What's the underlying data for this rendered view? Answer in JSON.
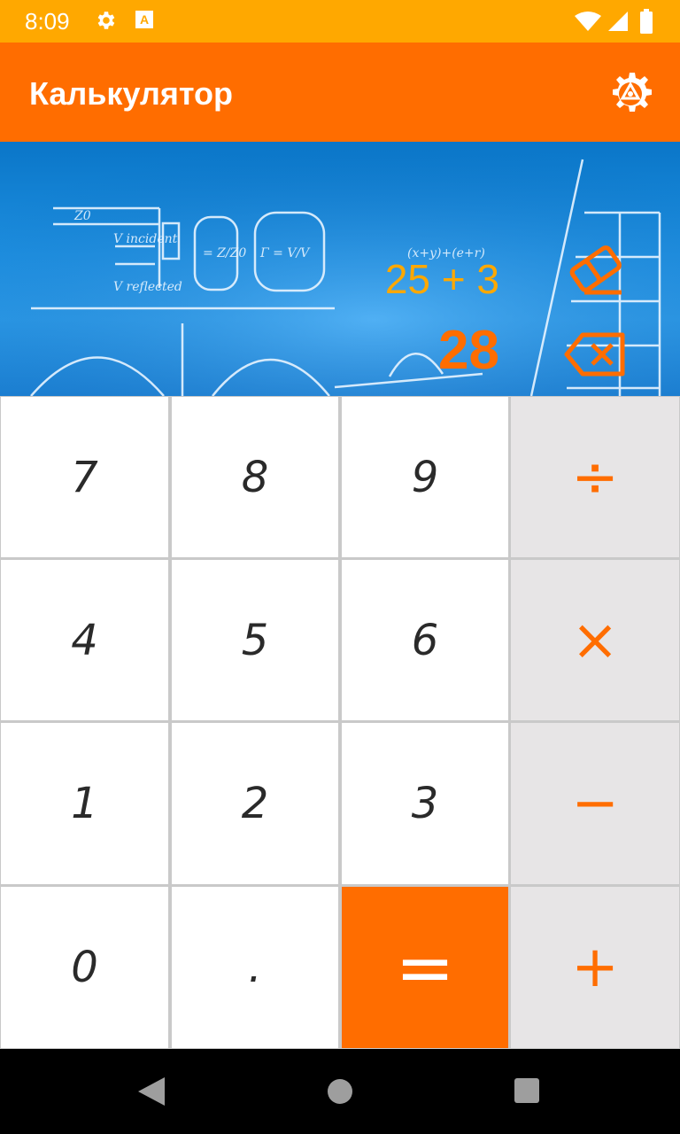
{
  "status_bar": {
    "time": "8:09",
    "background": "#ffa800"
  },
  "app_bar": {
    "title": "Калькулятор",
    "background": "#ff6d00"
  },
  "display": {
    "expression": "25 + 3",
    "result": "28",
    "expression_color": "#ffa800",
    "result_color": "#ff6d00"
  },
  "keypad": {
    "rows": [
      [
        {
          "label": "7",
          "type": "digit"
        },
        {
          "label": "8",
          "type": "digit"
        },
        {
          "label": "9",
          "type": "digit"
        },
        {
          "label": "÷",
          "type": "operator"
        }
      ],
      [
        {
          "label": "4",
          "type": "digit"
        },
        {
          "label": "5",
          "type": "digit"
        },
        {
          "label": "6",
          "type": "digit"
        },
        {
          "label": "×",
          "type": "operator"
        }
      ],
      [
        {
          "label": "1",
          "type": "digit"
        },
        {
          "label": "2",
          "type": "digit"
        },
        {
          "label": "3",
          "type": "digit"
        },
        {
          "label": "−",
          "type": "operator"
        }
      ],
      [
        {
          "label": "0",
          "type": "digit"
        },
        {
          "label": ".",
          "type": "digit"
        },
        {
          "label": "=",
          "type": "equals"
        },
        {
          "label": "+",
          "type": "operator"
        }
      ]
    ],
    "accent": "#ff6d00",
    "operator_background": "#e7e5e6"
  },
  "icons": {
    "settings": "gear-icon",
    "clear": "eraser-icon",
    "backspace": "backspace-icon",
    "nav_back": "back-triangle-icon",
    "nav_home": "home-circle-icon",
    "nav_recents": "recents-square-icon"
  }
}
